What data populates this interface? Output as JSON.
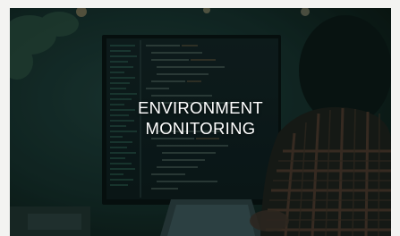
{
  "card": {
    "title_line1": "ENVIRONMENT",
    "title_line2": "MONITORING"
  },
  "colors": {
    "page_background": "#f3f3f1",
    "overlay": "#0a1c1a",
    "caption_text": "#ffffff"
  }
}
